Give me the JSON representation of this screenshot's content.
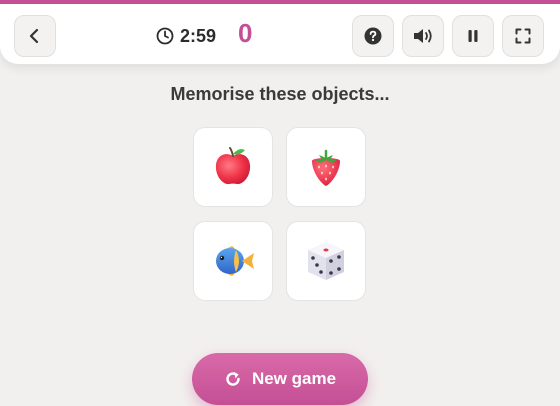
{
  "header": {
    "timer": "2:59",
    "score": "0"
  },
  "instruction": "Memorise these objects...",
  "objects": [
    {
      "name": "apple",
      "icon": "apple-icon"
    },
    {
      "name": "strawberry",
      "icon": "strawberry-icon"
    },
    {
      "name": "fish",
      "icon": "fish-icon"
    },
    {
      "name": "dice",
      "icon": "dice-icon"
    }
  ],
  "new_game_label": "New game",
  "colors": {
    "accent": "#c44f95",
    "background": "#f2f0ee"
  }
}
